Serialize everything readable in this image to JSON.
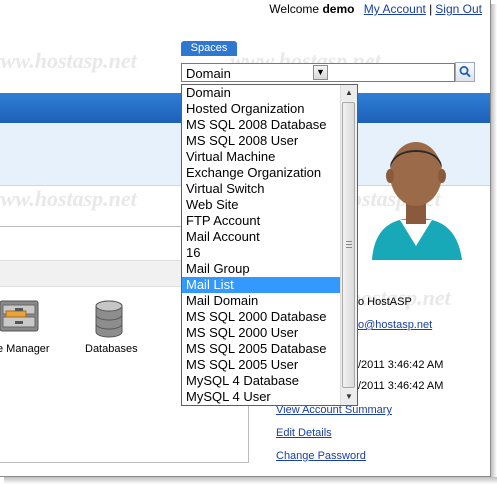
{
  "header": {
    "welcome_label": "Welcome",
    "username": "demo",
    "my_account": "My Account",
    "sign_out": "Sign Out"
  },
  "spaces": {
    "tab_label": "Spaces",
    "selected": "Domain",
    "options": [
      "Domain",
      "Hosted Organization",
      "MS SQL 2008 Database",
      "MS SQL 2008 User",
      "Virtual Machine",
      "Exchange Organization",
      "Virtual Switch",
      "Web Site",
      "FTP Account",
      "Mail Account",
      "16",
      "Mail Group",
      "Mail List",
      "Mail Domain",
      "MS SQL 2000 Database",
      "MS SQL 2000 User",
      "MS SQL 2005 Database",
      "MS SQL 2005 User",
      "MySQL 4 Database",
      "MySQL 4 User"
    ],
    "highlighted": "Mail List"
  },
  "watermark": "www.hostasp.net",
  "icons": {
    "file_manager_label": "e Manager",
    "databases_label": "Databases"
  },
  "account": {
    "name_fragment": "o HostASP",
    "email_fragment": "o@hostasp.net",
    "date1_fragment": "/2011 3:46:42 AM",
    "date2_fragment": "/2011 3:46:42 AM",
    "links": [
      "View Account Summary",
      "Edit Details",
      "Change Password"
    ]
  },
  "colors": {
    "accent_blue": "#2f7fd6",
    "link_blue": "#1a3fa6",
    "selection": "#3399ff"
  }
}
